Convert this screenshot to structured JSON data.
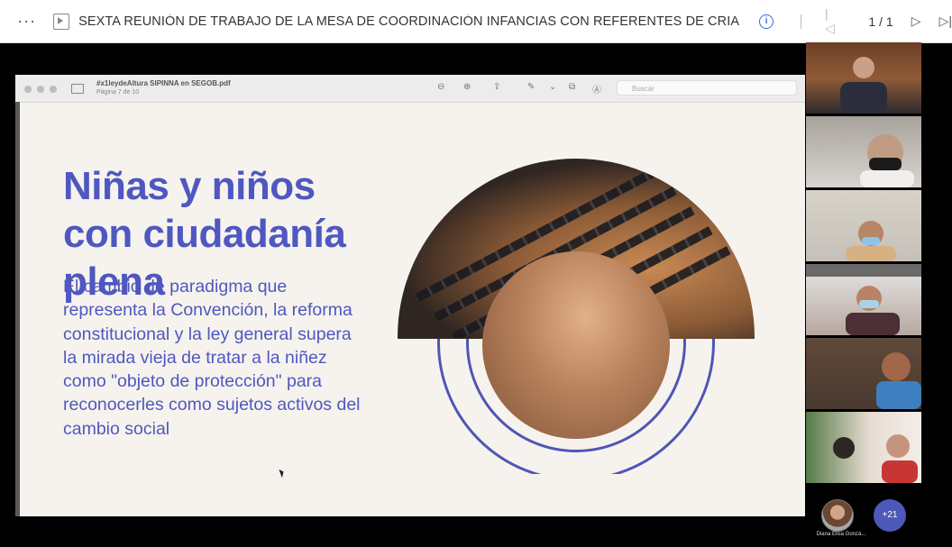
{
  "topbar": {
    "menu_glyph": "···",
    "title": "SEXTA REUNIÓN DE TRABAJO DE LA MESA DE COORDINACIÓN INFANCIAS CON REFERENTES DE CRIANZA EN PRISIÓN",
    "info_glyph": "i",
    "page_indicator": "1 / 1",
    "icons": [
      "menu-dots-icon",
      "presentation-icon",
      "info-icon",
      "first-page-icon",
      "next-page-icon",
      "last-page-icon"
    ]
  },
  "viewer": {
    "file_name": "#x1leydeAltura SIPINNA en SEGOB.pdf",
    "page_label": "Página 7 de 10",
    "search_placeholder": "Buscar"
  },
  "slide": {
    "title": "Niñas y niños con ciudadanía plena",
    "body": "El cambio de paradigma que representa la Convención, la reforma constitucional y la ley general supera la mirada vieja de tratar a la niñez como \"objeto de protección\" para reconocerles como sujetos activos del cambio social",
    "accent_color": "#4f57c0"
  },
  "participants": {
    "named_participant": "Diana Elisa Gonzá...",
    "more_count": "+21"
  }
}
